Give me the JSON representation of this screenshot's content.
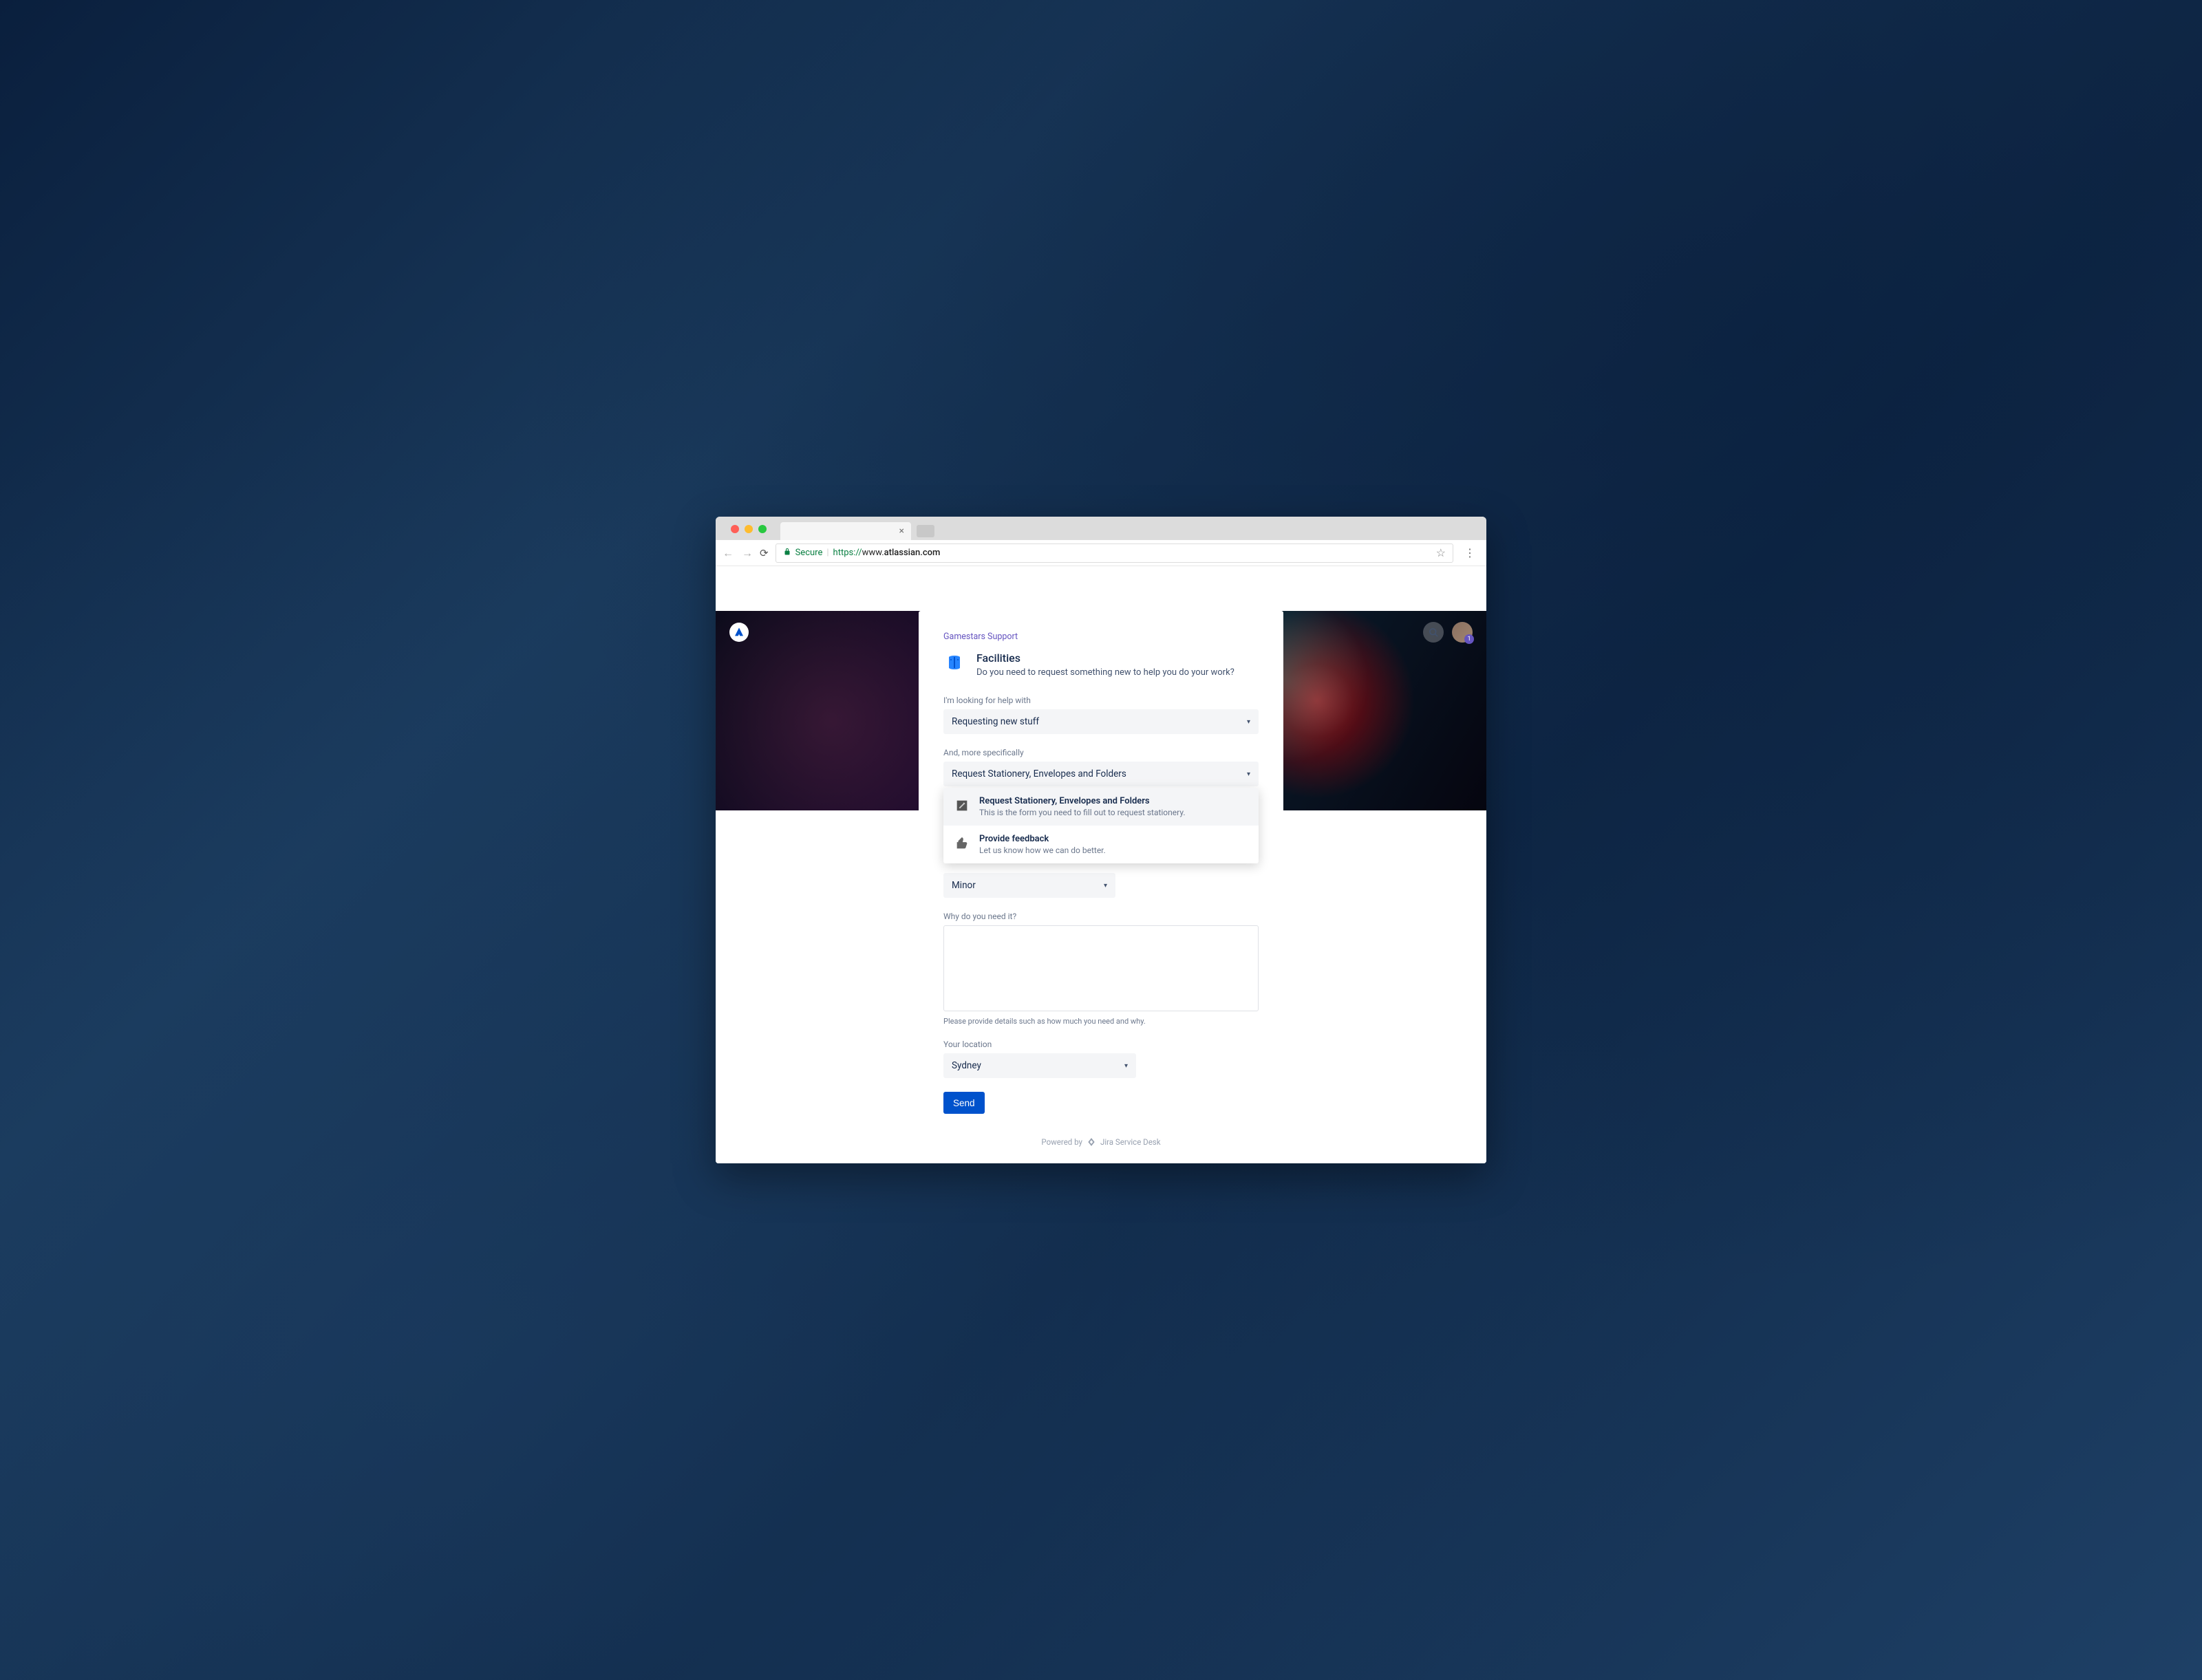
{
  "browser": {
    "secure_label": "Secure",
    "url_protocol": "https://",
    "url_host_prefix": "www.",
    "url_host_main": "atlassian.com"
  },
  "header": {
    "notification_count": "1"
  },
  "card": {
    "breadcrumb": "Gamestars Support",
    "title": "Facilities",
    "subtitle": "Do you need to request something new to help you do your work?"
  },
  "fields": {
    "help_with": {
      "label": "I'm looking for help with",
      "value": "Requesting new stuff"
    },
    "specifically": {
      "label": "And, more specifically",
      "value": "Request Stationery, Envelopes and Folders",
      "options": [
        {
          "title": "Request Stationery, Envelopes and Folders",
          "desc": "This is the form you need to fill out to request stationery."
        },
        {
          "title": "Provide feedback",
          "desc": "Let us know how we can do better."
        }
      ]
    },
    "priority": {
      "value": "Minor"
    },
    "why": {
      "label": "Why do you need it?",
      "hint": "Please provide details such as how much you need and why."
    },
    "location": {
      "label": "Your location",
      "value": "Sydney"
    }
  },
  "actions": {
    "send": "Send"
  },
  "footer": {
    "powered_by": "Powered by",
    "product": "Jira Service Desk"
  }
}
